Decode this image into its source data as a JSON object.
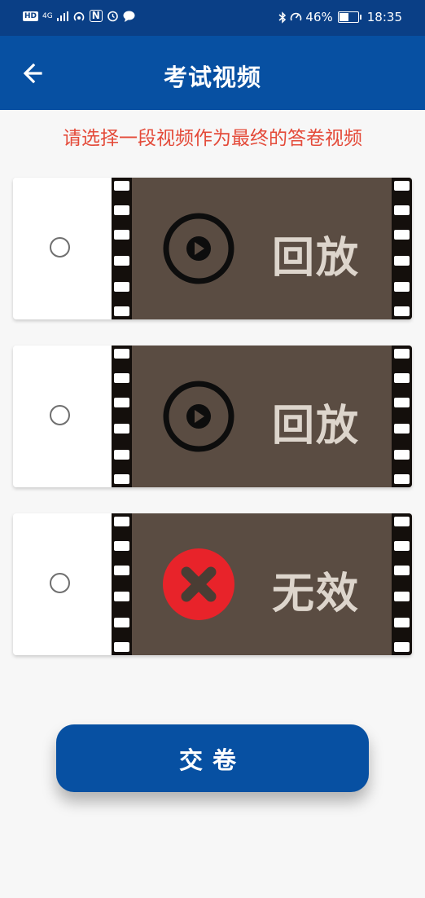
{
  "status_bar": {
    "hd": "HD",
    "network": "4G",
    "nfc": "N",
    "battery_text": "46%",
    "battery_level": 0.46,
    "time": "18:35"
  },
  "app_bar": {
    "title": "考试视频",
    "back_icon": "arrow-left-icon"
  },
  "instruction": "请选择一段视频作为最终的答卷视频",
  "videos": [
    {
      "label": "回放",
      "icon": "play-icon",
      "selected": false
    },
    {
      "label": "回放",
      "icon": "play-icon",
      "selected": false
    },
    {
      "label": "无效",
      "icon": "invalid-x-icon",
      "selected": false
    }
  ],
  "submit_label": "交卷",
  "colors": {
    "primary": "#0750a2",
    "status_bar": "#0a3f86",
    "instruction": "#e44b3a",
    "film": "#5a4c42",
    "invalid": "#e8232a"
  }
}
